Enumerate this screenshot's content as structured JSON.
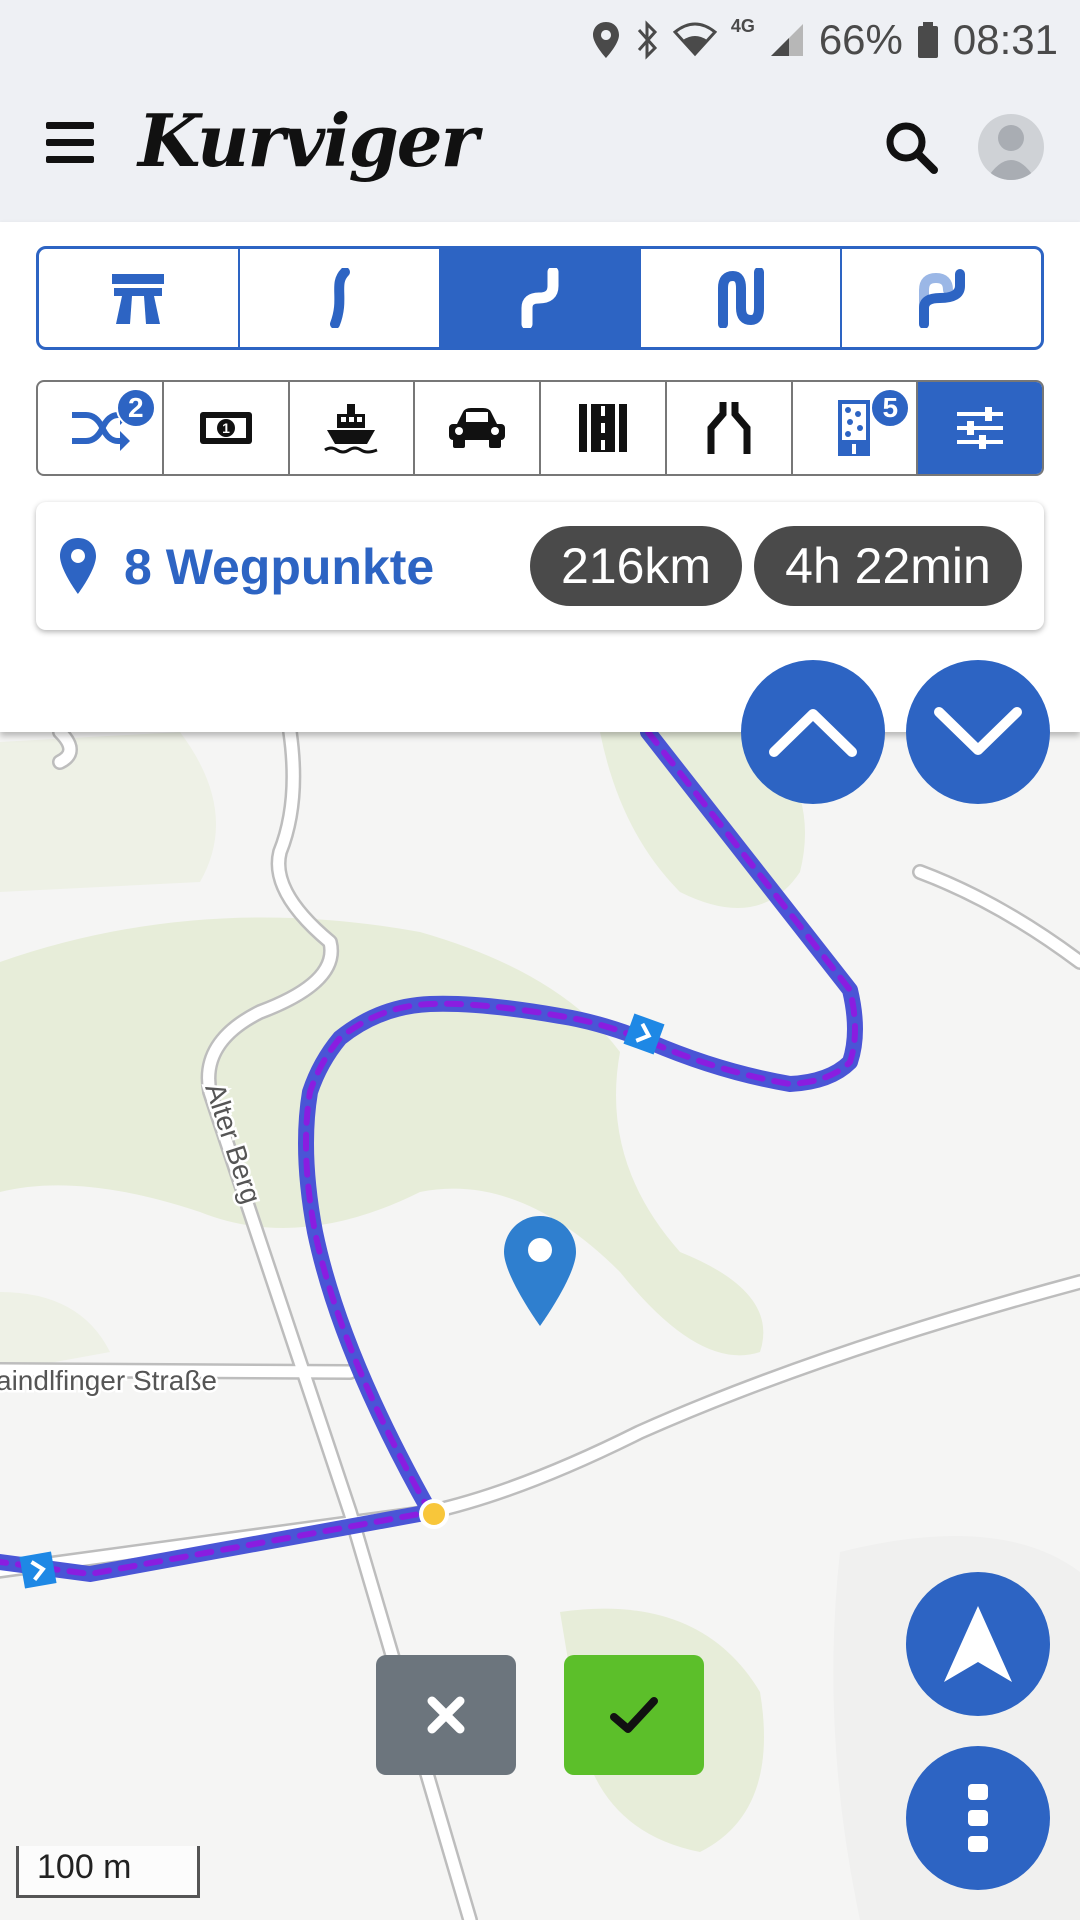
{
  "status_bar": {
    "battery": "66%",
    "time": "08:31",
    "network": "4G"
  },
  "app": {
    "logo_text": "Kurviger"
  },
  "curve_modes": [
    {
      "id": "fastest",
      "icon": "highway-icon",
      "active": false
    },
    {
      "id": "curvy",
      "icon": "slight-curve-icon",
      "active": false
    },
    {
      "id": "curvier",
      "icon": "curve-icon",
      "active": true
    },
    {
      "id": "curviest",
      "icon": "extra-curvy-icon",
      "active": false
    },
    {
      "id": "custom",
      "icon": "custom-curve-icon",
      "active": false
    }
  ],
  "options": [
    {
      "id": "shuffle",
      "icon": "shuffle-icon",
      "badge": "2"
    },
    {
      "id": "tolls",
      "icon": "money-icon",
      "badge": ""
    },
    {
      "id": "ferries",
      "icon": "ferry-icon",
      "badge": ""
    },
    {
      "id": "car",
      "icon": "car-icon",
      "badge": ""
    },
    {
      "id": "road",
      "icon": "road-icon",
      "badge": ""
    },
    {
      "id": "narrow",
      "icon": "narrow-road-icon",
      "badge": ""
    },
    {
      "id": "surface",
      "icon": "surface-icon",
      "badge": "5"
    },
    {
      "id": "settings",
      "icon": "sliders-icon",
      "badge": ""
    }
  ],
  "route": {
    "waypoints_label": "8 Wegpunkte",
    "distance": "216km",
    "duration": "4h 22min"
  },
  "map": {
    "street_labels": [
      "Alter Berg",
      "aindlfinger Straße"
    ],
    "scale_label": "100 m"
  },
  "colors": {
    "accent": "#2d64c3",
    "confirm": "#5cbf2a",
    "cancel": "#6c757d",
    "route_line": "#4a55d6",
    "route_dash": "#8a1de0"
  }
}
